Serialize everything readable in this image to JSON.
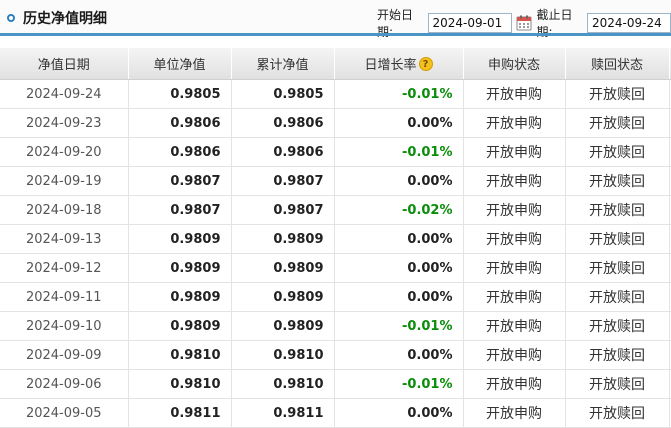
{
  "header": {
    "title": "历史净值明细",
    "start_label": "开始日期:",
    "start_value": "2024-09-01",
    "end_label": "截止日期:",
    "end_value": "2024-09-24"
  },
  "table": {
    "columns": [
      "净值日期",
      "单位净值",
      "累计净值",
      "日增长率",
      "申购状态",
      "赎回状态"
    ],
    "rows": [
      {
        "date": "2024-09-24",
        "unit": "0.9805",
        "accum": "0.9805",
        "rate": "-0.01%",
        "buy": "开放申购",
        "redeem": "开放赎回"
      },
      {
        "date": "2024-09-23",
        "unit": "0.9806",
        "accum": "0.9806",
        "rate": "0.00%",
        "buy": "开放申购",
        "redeem": "开放赎回"
      },
      {
        "date": "2024-09-20",
        "unit": "0.9806",
        "accum": "0.9806",
        "rate": "-0.01%",
        "buy": "开放申购",
        "redeem": "开放赎回"
      },
      {
        "date": "2024-09-19",
        "unit": "0.9807",
        "accum": "0.9807",
        "rate": "0.00%",
        "buy": "开放申购",
        "redeem": "开放赎回"
      },
      {
        "date": "2024-09-18",
        "unit": "0.9807",
        "accum": "0.9807",
        "rate": "-0.02%",
        "buy": "开放申购",
        "redeem": "开放赎回"
      },
      {
        "date": "2024-09-13",
        "unit": "0.9809",
        "accum": "0.9809",
        "rate": "0.00%",
        "buy": "开放申购",
        "redeem": "开放赎回"
      },
      {
        "date": "2024-09-12",
        "unit": "0.9809",
        "accum": "0.9809",
        "rate": "0.00%",
        "buy": "开放申购",
        "redeem": "开放赎回"
      },
      {
        "date": "2024-09-11",
        "unit": "0.9809",
        "accum": "0.9809",
        "rate": "0.00%",
        "buy": "开放申购",
        "redeem": "开放赎回"
      },
      {
        "date": "2024-09-10",
        "unit": "0.9809",
        "accum": "0.9809",
        "rate": "-0.01%",
        "buy": "开放申购",
        "redeem": "开放赎回"
      },
      {
        "date": "2024-09-09",
        "unit": "0.9810",
        "accum": "0.9810",
        "rate": "0.00%",
        "buy": "开放申购",
        "redeem": "开放赎回"
      },
      {
        "date": "2024-09-06",
        "unit": "0.9810",
        "accum": "0.9810",
        "rate": "-0.01%",
        "buy": "开放申购",
        "redeem": "开放赎回"
      },
      {
        "date": "2024-09-05",
        "unit": "0.9811",
        "accum": "0.9811",
        "rate": "0.00%",
        "buy": "开放申购",
        "redeem": "开放赎回"
      }
    ]
  },
  "icons": {
    "title_marker": "ring-bullet-icon",
    "calendar": "calendar-icon",
    "help": "question-mark-icon"
  },
  "colors": {
    "accent": "#4a95c6",
    "negative_rate": "#0a8d0a",
    "help_icon": "#f3c11e"
  }
}
